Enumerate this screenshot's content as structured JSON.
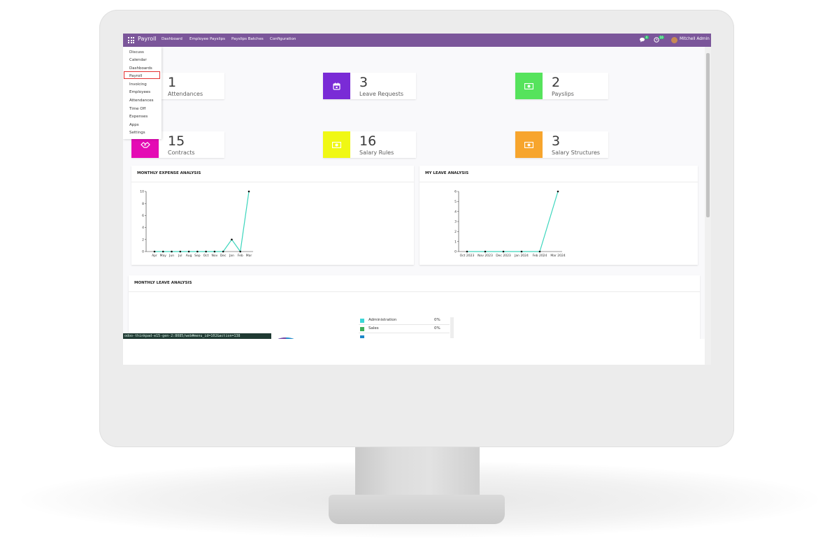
{
  "navbar": {
    "brand": "Payroll",
    "menu": [
      "Dashboard",
      "Employee Payslips",
      "Payslips Batches",
      "Configuration"
    ],
    "chat_badge": "4",
    "activity_badge": "10",
    "user": "Mitchell Admin"
  },
  "apps_menu": {
    "items": [
      "Discuss",
      "Calendar",
      "Dashboards",
      "Payroll",
      "Invoicing",
      "Employees",
      "Attendances",
      "Time Off",
      "Expenses",
      "Apps",
      "Settings"
    ],
    "active": "Payroll"
  },
  "tiles": [
    {
      "value": "1",
      "label": "Attendances",
      "color": "#3fc1c9",
      "icon": "user-clock-icon"
    },
    {
      "value": "3",
      "label": "Leave Requests",
      "color": "#7a2bd6",
      "icon": "calendar-icon"
    },
    {
      "value": "2",
      "label": "Payslips",
      "color": "#56e35c",
      "icon": "money-icon"
    },
    {
      "value": "15",
      "label": "Contracts",
      "color": "#e40bb4",
      "icon": "handshake-icon"
    },
    {
      "value": "16",
      "label": "Salary Rules",
      "color": "#f0f814",
      "icon": "money-icon"
    },
    {
      "value": "3",
      "label": "Salary Structures",
      "color": "#f7a52d",
      "icon": "money-icon"
    }
  ],
  "chart_data": [
    {
      "type": "line",
      "title": "MONTHLY EXPENSE ANALYSIS",
      "categories": [
        "Apr",
        "May",
        "Jun",
        "Jul",
        "Aug",
        "Sep",
        "Oct",
        "Nov",
        "Dec",
        "Jan",
        "Feb",
        "Mar"
      ],
      "values": [
        0,
        0,
        0,
        0,
        0,
        0,
        0,
        0,
        0,
        2,
        0,
        10
      ],
      "yticks": [
        0,
        2,
        4,
        6,
        8,
        10
      ],
      "ylim": [
        0,
        10
      ],
      "color": "#3cd6bd"
    },
    {
      "type": "line",
      "title": "MY LEAVE ANALYSIS",
      "categories": [
        "Oct 2023",
        "Nov 2023",
        "Dec 2023",
        "Jan 2024",
        "Feb 2024",
        "Mar 2024"
      ],
      "values": [
        0,
        0,
        0,
        0,
        0,
        6
      ],
      "yticks": [
        0,
        1,
        2,
        3,
        4,
        5,
        6
      ],
      "ylim": [
        0,
        6
      ],
      "color": "#3cd6bd"
    }
  ],
  "leave_card": {
    "title": "MONTHLY LEAVE ANALYSIS",
    "legend": [
      {
        "name": "Administration",
        "value": "0%",
        "color": "#3cd6d6"
      },
      {
        "name": "Sales",
        "value": "0%",
        "color": "#3fae5a"
      },
      {
        "name": "",
        "value": "",
        "color": "#1b87c9"
      }
    ]
  },
  "status_url": "odoo-thinkpad-e15-gen-2:8085/web#menu_id=102&action=138"
}
